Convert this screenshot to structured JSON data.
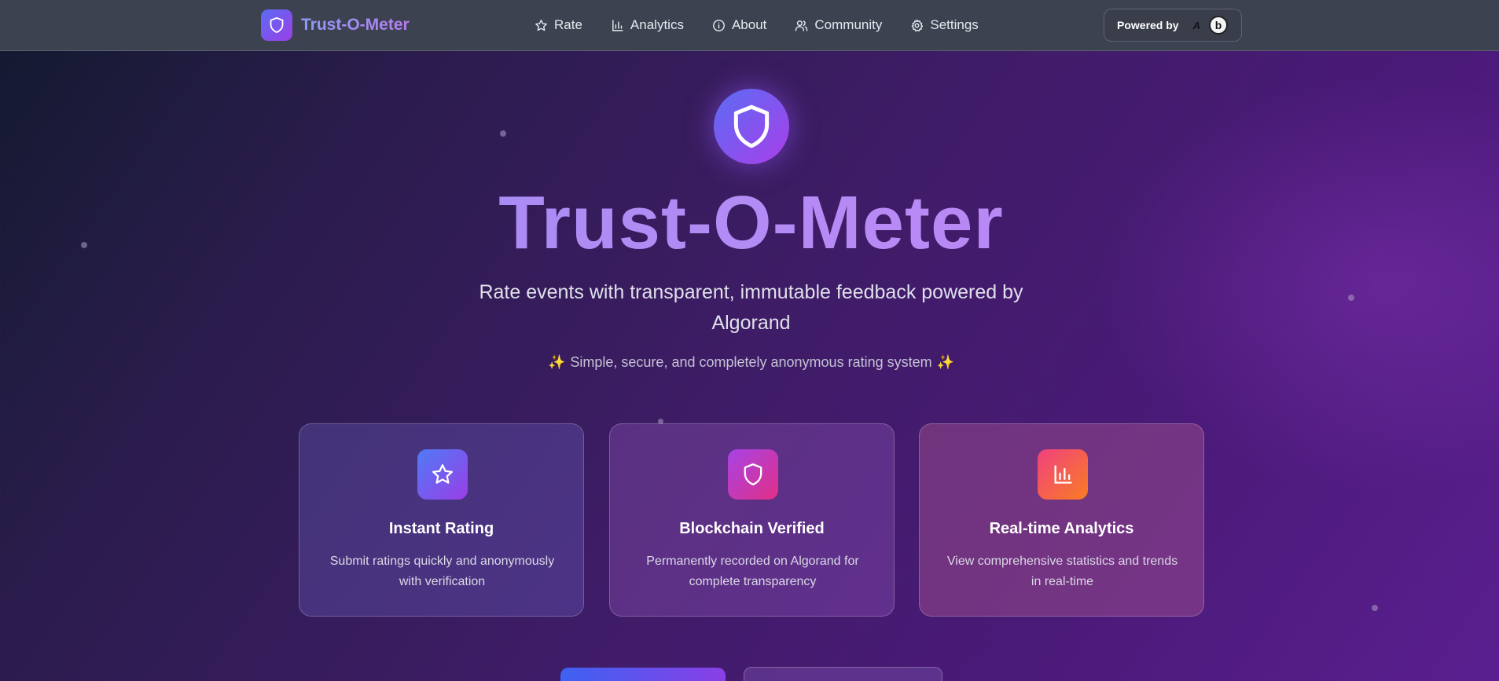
{
  "navbar": {
    "brand_name": "Trust-O-Meter",
    "items": [
      {
        "label": "Rate",
        "icon": "star-icon"
      },
      {
        "label": "Analytics",
        "icon": "bar-chart-icon"
      },
      {
        "label": "About",
        "icon": "info-icon"
      },
      {
        "label": "Community",
        "icon": "users-icon"
      },
      {
        "label": "Settings",
        "icon": "gear-icon"
      }
    ],
    "powered_by": {
      "label": "Powered by",
      "logos": [
        "algorand-logo",
        "b-logo"
      ],
      "b_logo_text": "b",
      "algo_logo_text": "A"
    }
  },
  "hero": {
    "title": "Trust-O-Meter",
    "subtitle": "Rate events with transparent, immutable feedback powered by Algorand",
    "tagline": "Simple, secure, and completely anonymous rating system",
    "sparkle": "✨"
  },
  "features": [
    {
      "title": "Instant Rating",
      "description": "Submit ratings quickly and anonymously with verification",
      "icon": "star-icon"
    },
    {
      "title": "Blockchain Verified",
      "description": "Permanently recorded on Algorand for complete transparency",
      "icon": "shield-icon"
    },
    {
      "title": "Real-time Analytics",
      "description": "View comprehensive statistics and trends in real-time",
      "icon": "bar-chart-icon"
    }
  ],
  "colors": {
    "accent_blue": "#4f7bf5",
    "accent_purple": "#9a3ee8",
    "accent_pink": "#e12f86",
    "accent_orange": "#f97d22",
    "navbar_bg": "#3d4250",
    "title_gradient": [
      "#9a8ff3",
      "#b67ef2"
    ]
  }
}
